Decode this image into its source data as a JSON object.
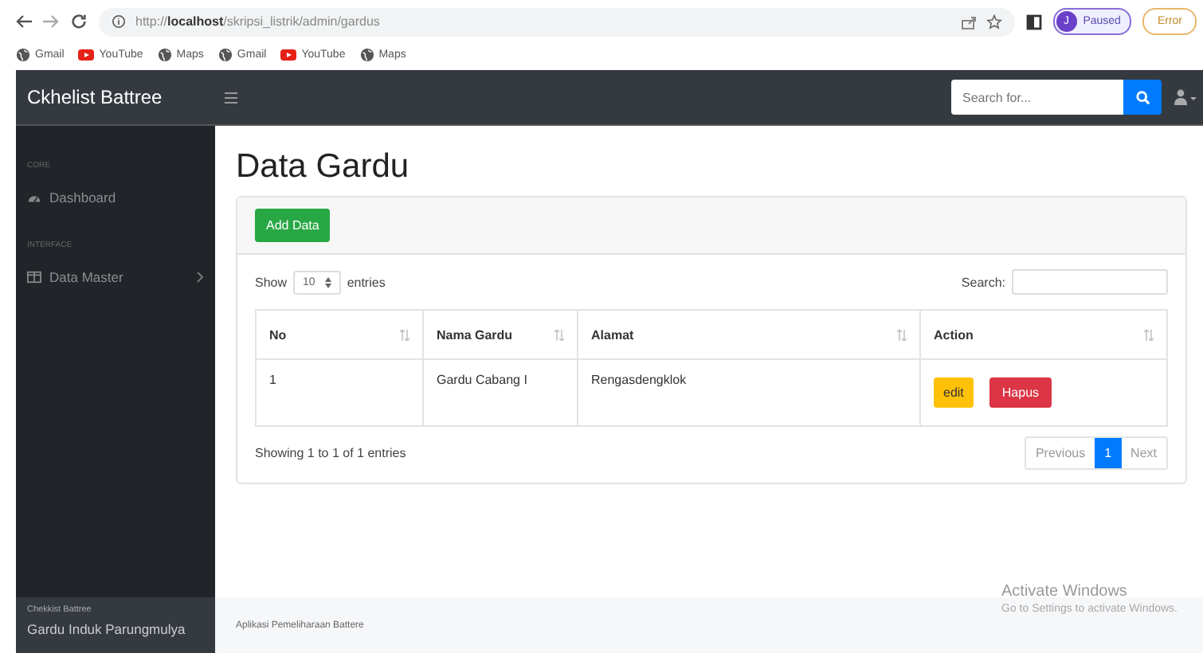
{
  "browser": {
    "url_prefix": "http://",
    "url_host": "localhost",
    "url_path": "/skripsi_listrik/admin/gardus",
    "profile_initial": "J",
    "profile_status": "Paused",
    "error_label": "Error",
    "bookmarks": [
      {
        "label": "Gmail",
        "kind": "globe"
      },
      {
        "label": "YouTube",
        "kind": "youtube"
      },
      {
        "label": "Maps",
        "kind": "globe"
      },
      {
        "label": "Gmail",
        "kind": "globe"
      },
      {
        "label": "YouTube",
        "kind": "youtube"
      },
      {
        "label": "Maps",
        "kind": "globe"
      }
    ]
  },
  "navbar": {
    "brand": "Ckhelist Battree",
    "search_placeholder": "Search for..."
  },
  "sidebar": {
    "sections": [
      {
        "heading": "CORE",
        "items": [
          {
            "label": "Dashboard",
            "kind": "dashboard",
            "has_children": false
          }
        ]
      },
      {
        "heading": "INTERFACE",
        "items": [
          {
            "label": "Data Master",
            "kind": "columns",
            "has_children": true
          }
        ]
      }
    ],
    "footer_small": "Chekkist Battree",
    "footer_name": "Gardu Induk Parungmulya"
  },
  "page_title": "Data Gardu",
  "add_button": "Add Data",
  "table": {
    "show_label": "Show",
    "page_size": "10",
    "entries_label": "entries",
    "search_label": "Search:",
    "columns": [
      "No",
      "Nama Gardu",
      "Alamat",
      "Action"
    ],
    "rows": [
      {
        "cells": [
          "1",
          "Gardu Cabang I",
          "Rengasdengklok"
        ],
        "actions": [
          {
            "label": "edit",
            "kind": "warning"
          },
          {
            "label": "Hapus",
            "kind": "danger"
          }
        ]
      }
    ],
    "info": "Showing 1 to 1 of 1 entries",
    "pagination": [
      {
        "label": "Previous",
        "selected": false
      },
      {
        "label": "1",
        "selected": true
      },
      {
        "label": "Next",
        "selected": false
      }
    ]
  },
  "footer": "Aplikasi Pemeliharaan Battere",
  "os_notice": {
    "title": "Activate Windows",
    "text": "Go to Settings to activate Windows."
  }
}
